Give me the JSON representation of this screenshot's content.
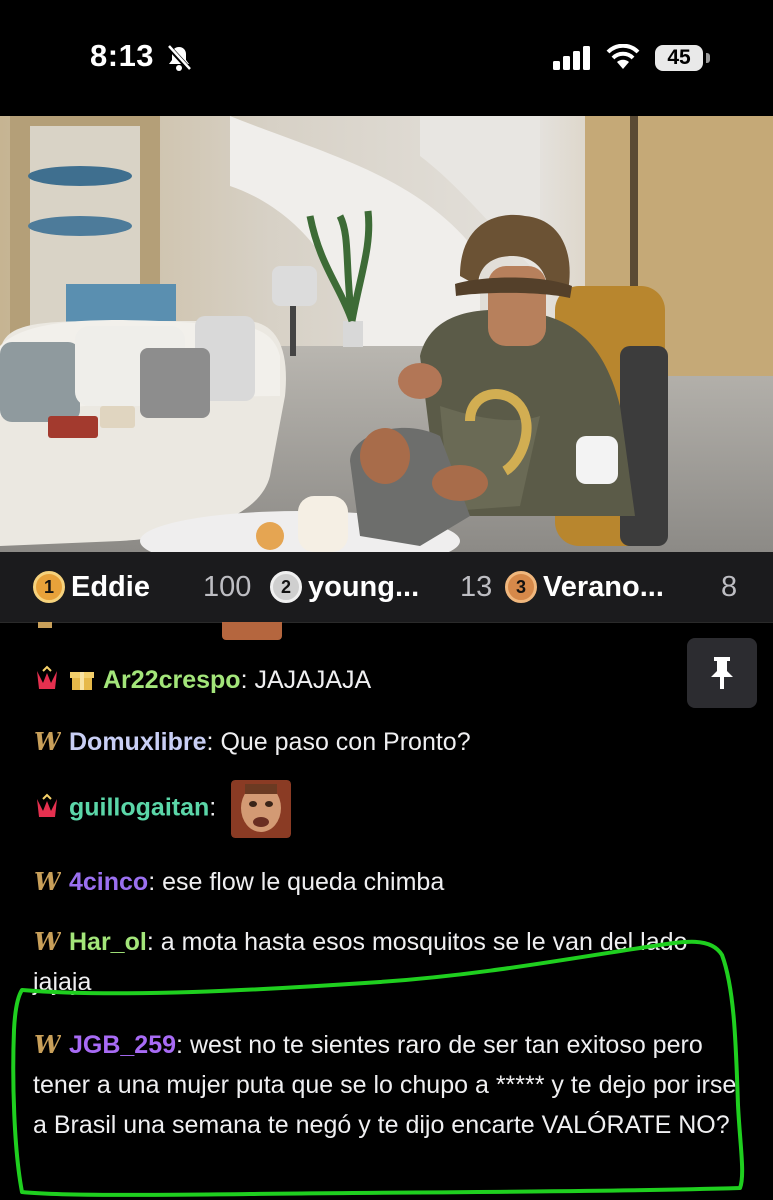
{
  "status_bar": {
    "time": "8:13",
    "battery": "45",
    "icons": [
      "bell-muted-icon",
      "signal-icon",
      "wifi-icon",
      "battery-icon"
    ]
  },
  "video": {
    "description_icon": "stream-video"
  },
  "leaderboard": [
    {
      "rank": "1",
      "name": "Eddie",
      "score": "100",
      "medal_color": "#e8a23a"
    },
    {
      "rank": "2",
      "name": "young...",
      "score": "13",
      "medal_color": "#cfcfcf"
    },
    {
      "rank": "3",
      "name": "Verano...",
      "score": "8",
      "medal_color": "#d6894a"
    }
  ],
  "chat": {
    "messages": [
      {
        "user": "Ar22crespo",
        "sep": ": ",
        "text": "JAJAJAJA",
        "color": "#a3e57a"
      },
      {
        "user": "Domuxlibre",
        "sep": ": ",
        "text": "Que paso con Pronto?",
        "color": "#c9cff5"
      },
      {
        "user": "guillogaitan",
        "sep": ":",
        "text": "",
        "color": "#5bd6a8"
      },
      {
        "user": "4cinco",
        "sep": ": ",
        "text": "ese flow le queda chimba",
        "color": "#9b70f0"
      },
      {
        "user": "Har_ol",
        "sep": ": ",
        "text": "a mota hasta esos mosquitos se le van del lado jajaja",
        "color": "#a3e57a"
      },
      {
        "user": "JGB_259",
        "sep": ": ",
        "text": "west no te sientes raro de ser tan exitoso pero tener a una mujer puta que se lo chupo a ***** y te dejo por irse a Brasil una semana te negó y te dijo encarte VALÓRATE NO?",
        "color": "#a86bf5"
      }
    ],
    "pin_icon": "pin-icon"
  }
}
